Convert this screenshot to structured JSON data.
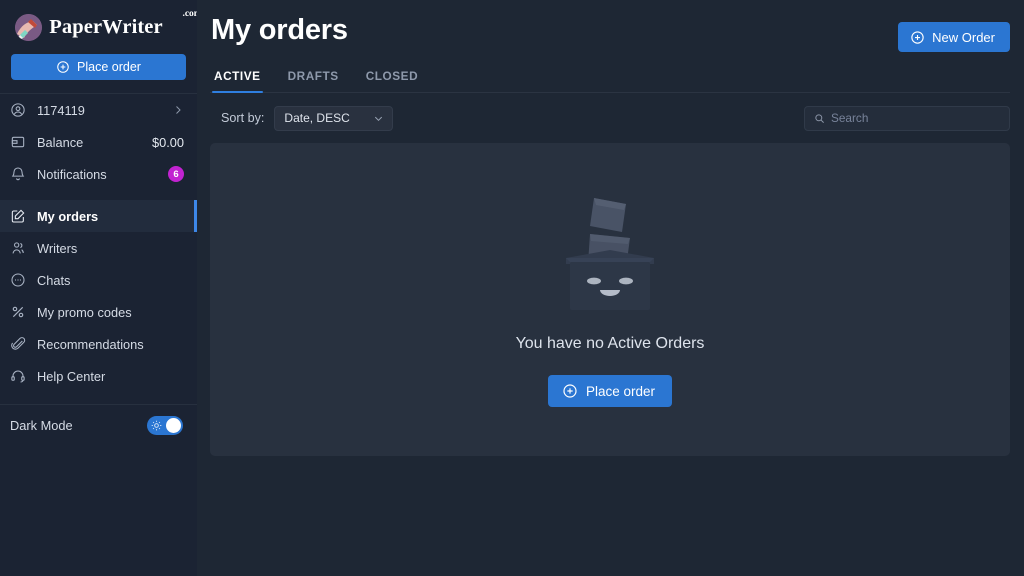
{
  "brand": {
    "name": "PaperWriter",
    "tld": ".com",
    "logo_icon": "writing-hand-icon",
    "logo_circle_color": "#7a5a84"
  },
  "colors": {
    "accent_blue": "#2b76d2",
    "tab_underline": "#2f7fe0",
    "badge_magenta": "#c223d1",
    "sidebar_bg": "#1b2333",
    "page_bg": "#1e2734",
    "card_bg": "#28313f"
  },
  "sidebar": {
    "place_order_label": "Place order",
    "place_order_icon": "plus-circle-icon",
    "account": {
      "icon": "user-circle-icon",
      "id": "1174119",
      "chevron_icon": "chevron-right-icon"
    },
    "balance": {
      "icon": "wallet-icon",
      "label": "Balance",
      "value": "$0.00"
    },
    "notifications": {
      "icon": "bell-icon",
      "label": "Notifications",
      "count": "6"
    },
    "nav_items": [
      {
        "label": "My orders",
        "icon": "edit-square-icon",
        "active": true
      },
      {
        "label": "Writers",
        "icon": "writers-people-icon",
        "active": false
      },
      {
        "label": "Chats",
        "icon": "chat-bubble-icon",
        "active": false
      },
      {
        "label": "My promo codes",
        "icon": "percent-icon",
        "active": false
      },
      {
        "label": "Recommendations",
        "icon": "paperclip-icon",
        "active": false
      },
      {
        "label": "Help Center",
        "icon": "headset-icon",
        "active": false
      }
    ],
    "dark_mode": {
      "label": "Dark Mode",
      "state": "on",
      "toggle_icon": "sun-icon"
    }
  },
  "header": {
    "title": "My orders",
    "new_order_label": "New Order",
    "new_order_icon": "plus-circle-icon"
  },
  "tabs": [
    {
      "label": "ACTIVE",
      "active": true
    },
    {
      "label": "DRAFTS",
      "active": false
    },
    {
      "label": "CLOSED",
      "active": false
    }
  ],
  "toolbar": {
    "sort_label": "Sort by:",
    "sort_value": "Date, DESC",
    "sort_chevron_icon": "chevron-down-icon",
    "search_icon": "search-icon",
    "search_placeholder": "Search",
    "search_value": ""
  },
  "empty_state": {
    "illustration": "empty-box-with-papers-icon",
    "message": "You have no Active Orders",
    "button_label": "Place order",
    "button_icon": "plus-circle-icon"
  }
}
